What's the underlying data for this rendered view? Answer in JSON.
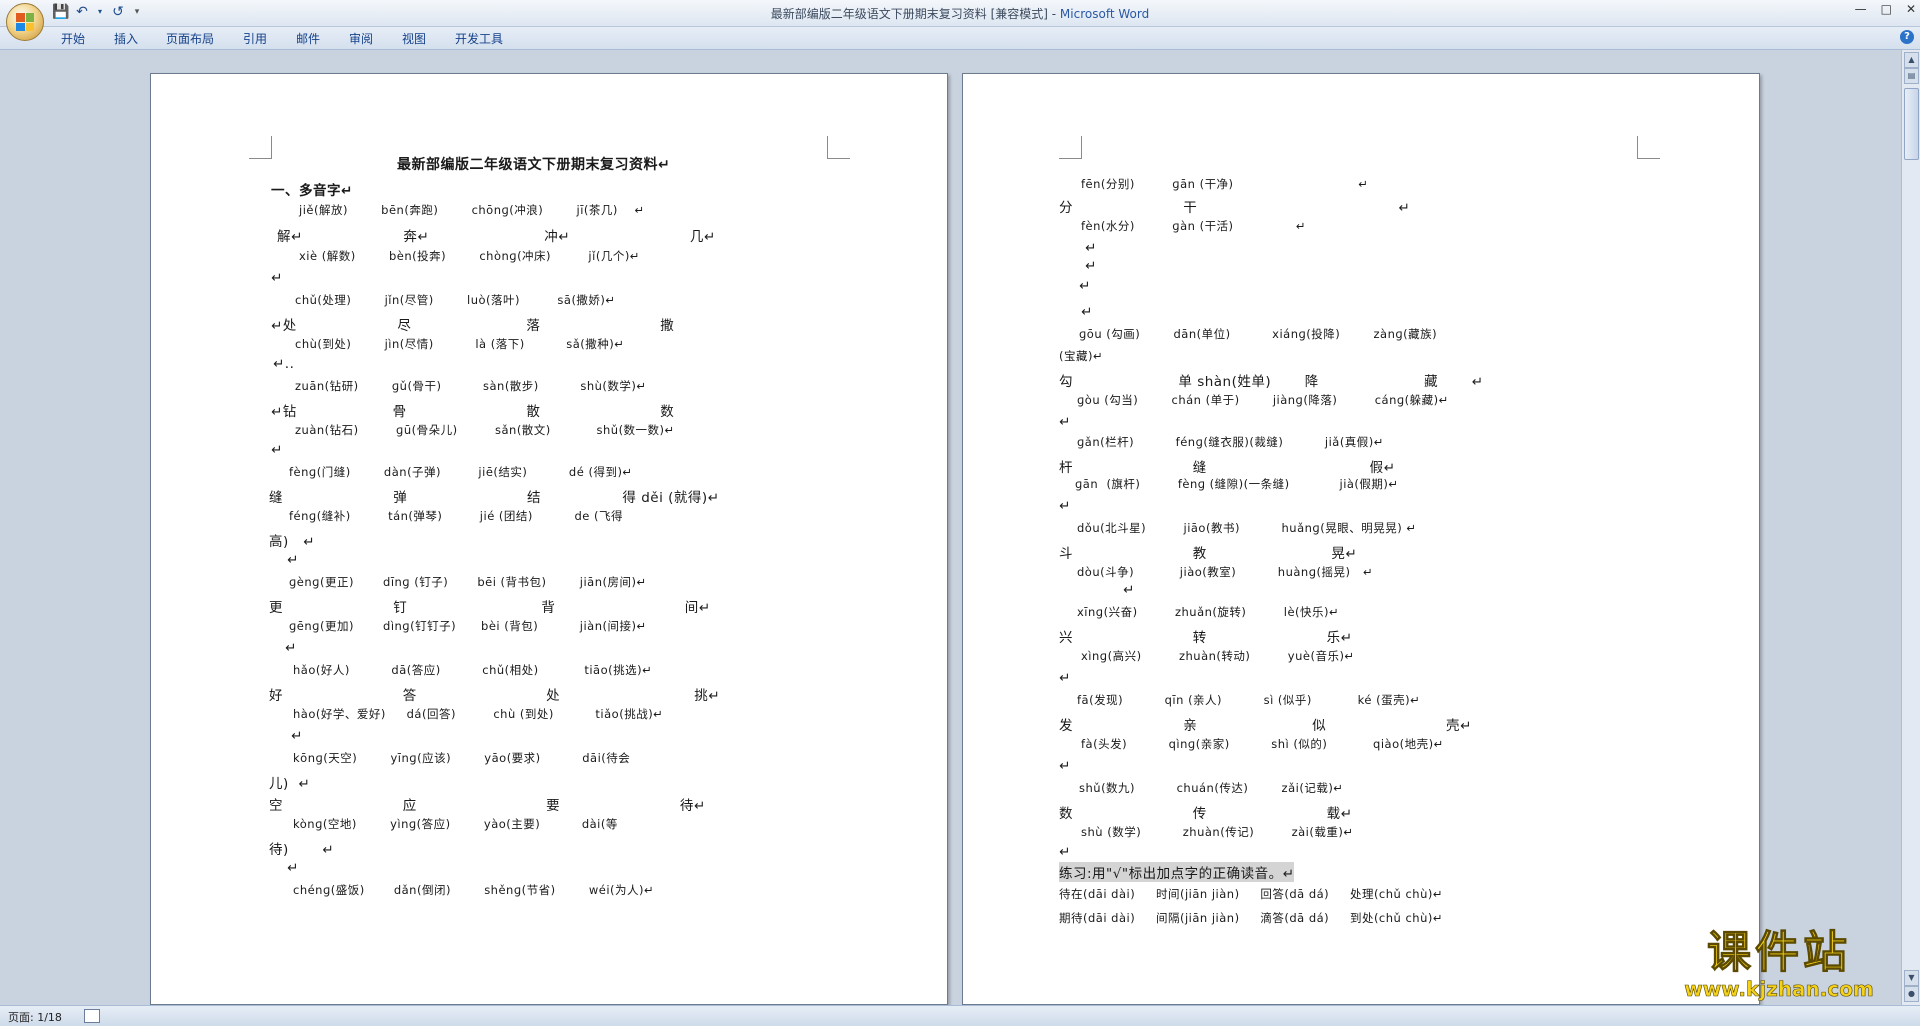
{
  "window": {
    "doc_title": "最新部编版二年级语文下册期末复习资料 [兼容模式] - ",
    "app_name": "Microsoft Word"
  },
  "ribbon_tabs": [
    "开始",
    "插入",
    "页面布局",
    "引用",
    "邮件",
    "审阅",
    "视图",
    "开发工具"
  ],
  "status": {
    "page": "页面: 1/18"
  },
  "page1": {
    "lines": [
      "最新部编版二年级语文下册期末复习资料↵",
      "一、多音字↵",
      "jiě(解放)        bēn(奔跑)        chōnɡ(冲浪)        jī(茶几)    ↵",
      "解↵                     奔↵                        冲↵                         几↵",
      "xiè (解数)        bèn(投奔)        chònɡ(冲床)         jǐ(几个)↵",
      "↵",
      "chǔ(处理)        jǐn(尽管)        luò(落叶)         sā(撒娇)↵",
      "↵处                     尽                        落                         撒",
      "chù(到处)        jìn(尽情)          là (落下)          sǎ(撒种)↵",
      "↵..",
      "zuān(钻研)        ɡǔ(骨干)          sàn(散步)          shù(数学)↵",
      "↵钻                    骨                         散                         数",
      "zuàn(钻石)         ɡū(骨朵儿)         sǎn(散文)           shǔ(数一数)↵",
      "↵",
      "fènɡ(门缝)        dàn(子弹)         jiē(结实)          dé (得到)↵",
      "缝                       弹                         结                 得 děi (就得)↵",
      "fénɡ(缝补)         tán(弹琴)         jié (团结)          de (飞得",
      "高)   ↵",
      "↵",
      "ɡènɡ(更正)       dīnɡ (钉子)       bēi (背书包)        jiān(房间)↵",
      "更                       钉                            背                           间↵",
      "ɡēnɡ(更加)       dìnɡ(钉钉子)      bèi (背包)          jiàn(间接)↵",
      "↵",
      "hǎo(好人)          dā(答应)          chǔ(相处)           tiāo(挑选)↵",
      "好                         答                           处                            挑↵",
      "hào(好学、爱好)     dá(回答)         chù (到处)          tiǎo(挑战)↵",
      "↵",
      "kōnɡ(天空)        yīnɡ(应该)        yāo(要求)          dāi(待会",
      "儿)  ↵",
      "空                         应                           要                         待↵",
      "kònɡ(空地)        yìnɡ(答应)        yào(主要)          dài(等",
      "待)       ↵",
      "↵",
      "chénɡ(盛饭)       dǎn(倒闭)        shěnɡ(节省)        wéi(为人)↵"
    ]
  },
  "page2": {
    "lines": [
      "fēn(分别)         ɡān (干净)                              ↵",
      "分                       干                                          ↵",
      "fèn(水分)         ɡàn (干活)               ↵",
      "↵",
      "↵",
      "↵",
      "↵",
      "ɡōu (勾画)        dān(单位)          xiánɡ(投降)        zànɡ(藏族)",
      "(宝藏)↵",
      "勾                      单 shàn(姓单)       降                      藏       ↵",
      "ɡòu (勾当)        chán (单于)        jiànɡ(降落)         cánɡ(躲藏)↵",
      "↵",
      "ɡǎn(栏杆)          fénɡ(缝衣服)(裁缝)          jiǎ(真假)↵",
      "杆                         缝                                  假↵",
      "ɡān  (旗杆)         fènɡ (缝隙)(一条缝)            jià(假期)↵",
      "↵",
      "dǒu(北斗星)         jiāo(教书)          huǎnɡ(晃眼、明晃晃) ↵",
      "斗                         教                          晃↵",
      "dòu(斗争)           jiào(教室)          huànɡ(摇晃)   ↵",
      "↵",
      "xīnɡ(兴奋)         zhuǎn(旋转)         lè(快乐)↵",
      "兴                         转                         乐↵",
      "xìnɡ(高兴)         zhuàn(转动)         yuè(音乐)↵",
      "↵",
      "fā(发现)          qīn (亲人)          sì (似乎)           ké (蛋壳)↵",
      "发                       亲                        似                         壳↵",
      "fà(头发)          qìnɡ(亲家)          shì (似的)           qiào(地壳)↵",
      "↵",
      "shǔ(数九)          chuán(传达)        zǎi(记载)↵",
      "数                         传                         载↵",
      "shù (数学)          zhuàn(传记)         zài(载重)↵",
      "↵",
      "练习:用\"√\"标出加点字的正确读音。↵",
      "待在(dāi dài)     时间(jiān jiàn)     回答(dā dá)     处理(chǔ chù)↵",
      "期待(dāi dài)     间隔(jiān jiàn)     滴答(dā dá)     到处(chǔ chù)↵"
    ]
  },
  "watermark": {
    "text": "课件站",
    "url": "www.kjzhan.com"
  }
}
